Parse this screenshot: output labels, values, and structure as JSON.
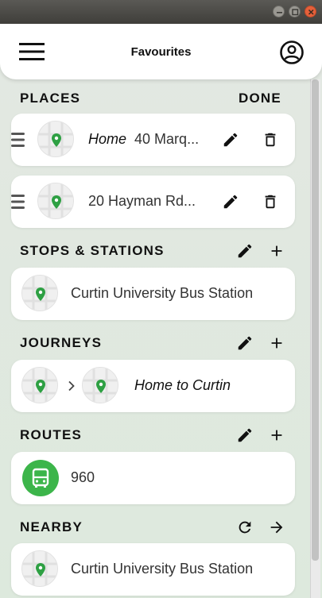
{
  "window": {
    "title_buttons": [
      "minimize",
      "maximize",
      "close"
    ]
  },
  "appbar": {
    "title": "Favourites",
    "menu_icon": "hamburger-menu-icon",
    "account_icon": "account-circle-icon"
  },
  "places": {
    "header": "PLACES",
    "action": "DONE",
    "items": [
      {
        "name": "Home",
        "address": "40 Marq..."
      },
      {
        "name": "",
        "address": "20 Hayman Rd..."
      }
    ]
  },
  "stops": {
    "header": "STOPS & STATIONS",
    "items": [
      {
        "name": "Curtin University Bus Station"
      }
    ]
  },
  "journeys": {
    "header": "JOURNEYS",
    "items": [
      {
        "name": "Home to Curtin"
      }
    ]
  },
  "routes": {
    "header": "ROUTES",
    "items": [
      {
        "number": "960"
      }
    ]
  },
  "nearby": {
    "header": "NEARBY",
    "items": [
      {
        "name": "Curtin University Bus Station"
      }
    ]
  },
  "colors": {
    "accent": "#3cb54a",
    "background": "#dfe8df",
    "card": "#ffffff"
  }
}
